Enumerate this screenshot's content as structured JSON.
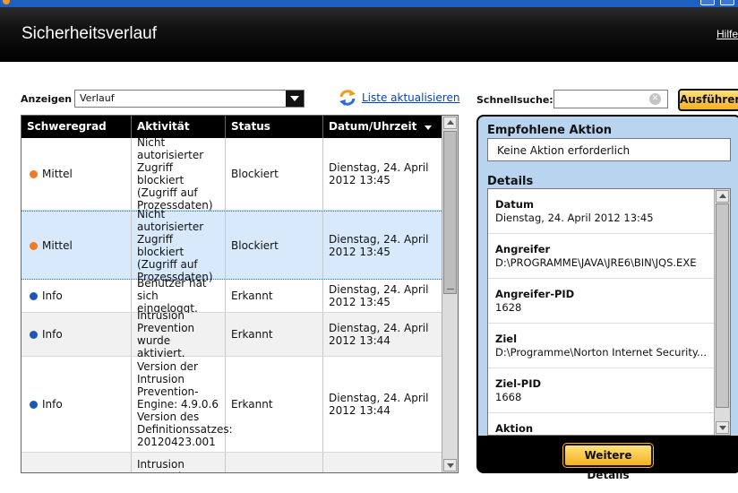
{
  "header": {
    "title": "Sicherheitsverlauf",
    "help": "Hilfe"
  },
  "toolbar": {
    "show_label": "Anzeigen",
    "show_value": "Verlauf",
    "refresh_label": "Liste aktualisieren",
    "quicksearch_label": "Schnellsuche:",
    "quicksearch_value": "",
    "run_label": "Ausführen"
  },
  "grid": {
    "columns": [
      "Schweregrad",
      "Aktivität",
      "Status",
      "Datum/Uhrzeit"
    ],
    "rows": [
      {
        "severity": "Mittel",
        "activity": "Nicht autorisierter Zugriff blockiert (Zugriff auf Prozessdaten)",
        "status": "Blockiert",
        "datetime": "Dienstag, 24. April 2012 13:45"
      },
      {
        "severity": "Mittel",
        "activity": "Nicht autorisierter Zugriff blockiert (Zugriff auf Prozessdaten)",
        "status": "Blockiert",
        "datetime": "Dienstag, 24. April 2012 13:45"
      },
      {
        "severity": "Info",
        "activity": "Benutzer hat sich eingeloggt.",
        "status": "Erkannt",
        "datetime": "Dienstag, 24. April 2012 13:45"
      },
      {
        "severity": "Info",
        "activity": "Intrusion Prevention wurde aktiviert.",
        "status": "Erkannt",
        "datetime": "Dienstag, 24. April 2012 13:44"
      },
      {
        "severity": "Info",
        "activity": "Version der Intrusion Prevention-Engine: 4.9.0.6 Version des Definitionssatzes: 20120423.001",
        "status": "Erkannt",
        "datetime": "Dienstag, 24. April 2012 13:44"
      },
      {
        "severity": "",
        "activity": "Intrusion Prevention",
        "status": "",
        "datetime": ""
      }
    ]
  },
  "panel": {
    "recommended_title": "Empfohlene Aktion",
    "recommended_value": "Keine Aktion erforderlich",
    "details_title": "Details",
    "details": [
      {
        "key": "Datum",
        "value": "Dienstag, 24. April 2012 13:45"
      },
      {
        "key": "Angreifer",
        "value": "D:\\PROGRAMME\\JAVA\\JRE6\\BIN\\JQS.EXE"
      },
      {
        "key": "Angreifer-PID",
        "value": "1628"
      },
      {
        "key": "Ziel",
        "value": "D:\\Programme\\Norton Internet Security..."
      },
      {
        "key": "Ziel-PID",
        "value": "1668"
      },
      {
        "key": "Aktion",
        "value": ""
      }
    ],
    "more_label": "Weitere Details"
  },
  "colors": {
    "accent": "#f5b120",
    "panel_bg": "#b9d4ee",
    "severity_medium": "#f07b21",
    "severity_info": "#1b57b9"
  }
}
